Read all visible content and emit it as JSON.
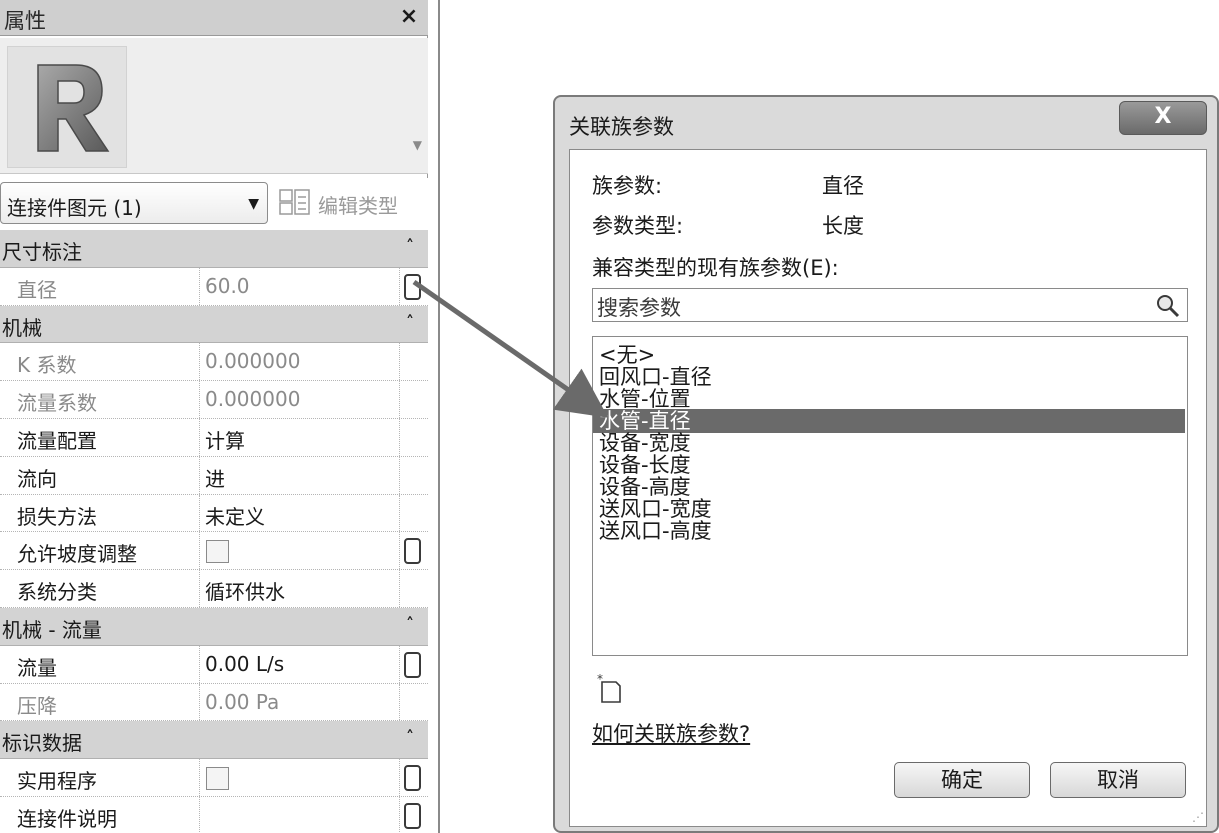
{
  "properties_panel": {
    "title": "属性",
    "close_glyph": "×",
    "instance_selector": "连接件图元 (1)",
    "edit_type_label": "编辑类型",
    "groups": [
      {
        "name": "尺寸标注",
        "rows": [
          {
            "name": "直径",
            "value": "60.0",
            "dim": true,
            "assoc": true
          }
        ]
      },
      {
        "name": "机械",
        "rows": [
          {
            "name": "K 系数",
            "value": "0.000000",
            "dim": true
          },
          {
            "name": "流量系数",
            "value": "0.000000",
            "dim": true
          },
          {
            "name": "流量配置",
            "value": "计算"
          },
          {
            "name": "流向",
            "value": "进"
          },
          {
            "name": "损失方法",
            "value": "未定义"
          },
          {
            "name": "允许坡度调整",
            "checkbox": true,
            "assoc": true
          },
          {
            "name": "系统分类",
            "value": "循环供水"
          }
        ]
      },
      {
        "name": "机械 - 流量",
        "rows": [
          {
            "name": "流量",
            "value": "0.00 L/s",
            "assoc": true
          },
          {
            "name": "压降",
            "value": "0.00 Pa",
            "dim": true
          }
        ]
      },
      {
        "name": "标识数据",
        "rows": [
          {
            "name": "实用程序",
            "checkbox": true,
            "assoc": true
          },
          {
            "name": "连接件说明",
            "value": "",
            "assoc": true
          }
        ]
      }
    ]
  },
  "dialog": {
    "title": "关联族参数",
    "close_label": "X",
    "family_param_label": "族参数:",
    "family_param_value": "直径",
    "param_type_label": "参数类型:",
    "param_type_value": "长度",
    "compatible_label": "兼容类型的现有族参数(E):",
    "search_placeholder": "搜索参数",
    "params": [
      "<无>",
      "回风口-直径",
      "水管-位置",
      "水管-直径",
      "设备-宽度",
      "设备-长度",
      "设备-高度",
      "送风口-宽度",
      "送风口-高度"
    ],
    "selected_index": 3,
    "help_link": "如何关联族参数?",
    "ok_label": "确定",
    "cancel_label": "取消"
  }
}
